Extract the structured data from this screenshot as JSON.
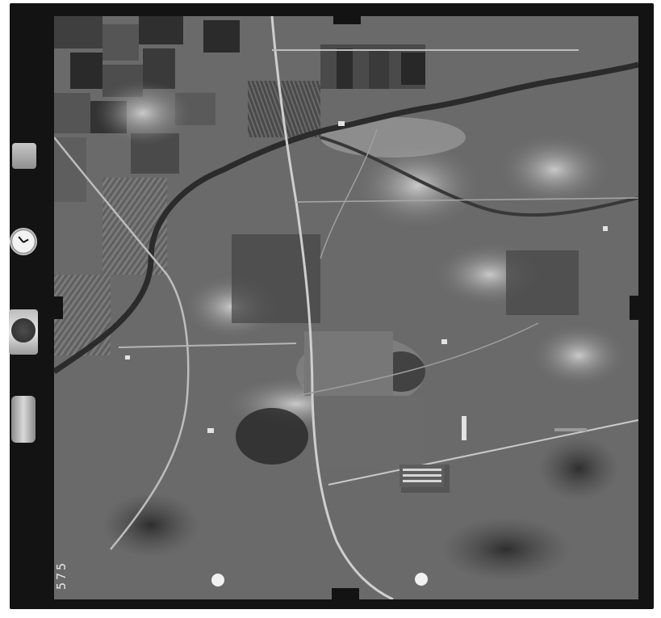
{
  "image": {
    "kind": "aerial photograph",
    "frame_number": "575",
    "strip": {
      "counter_chip_text": "",
      "altimeter_top_text": "",
      "altimeter_bottom_text": ""
    }
  },
  "colors": {
    "film_frame": "#131313",
    "field_dark": "#3a3a3a",
    "field_mid": "#6e6e6e",
    "field_light": "#a9a9a9",
    "road": "#cfcfcf",
    "river": "#2b2b2b"
  },
  "icons": {
    "clock": "clock-icon",
    "altimeter": "altimeter-icon",
    "level": "level-bubble-icon",
    "fiducial": "fiducial-mark-icon"
  }
}
